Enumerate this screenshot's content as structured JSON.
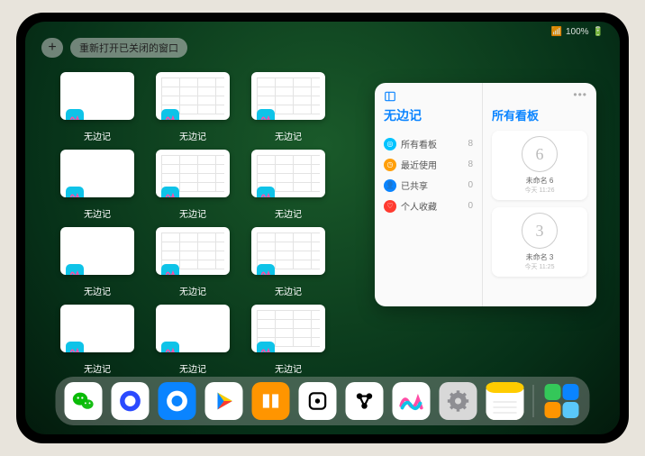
{
  "status": {
    "battery": "100%",
    "signal": "••••"
  },
  "topbar": {
    "reopen_label": "重新打开已关闭的窗口",
    "plus_glyph": "+"
  },
  "windows": [
    {
      "label": "无边记",
      "style": "blank"
    },
    {
      "label": "无边记",
      "style": "cal"
    },
    {
      "label": "无边记",
      "style": "cal"
    },
    {
      "label": "无边记",
      "style": "blank"
    },
    {
      "label": "无边记",
      "style": "cal"
    },
    {
      "label": "无边记",
      "style": "cal"
    },
    {
      "label": "无边记",
      "style": "blank"
    },
    {
      "label": "无边记",
      "style": "cal"
    },
    {
      "label": "无边记",
      "style": "cal"
    },
    {
      "label": "无边记",
      "style": "blank"
    },
    {
      "label": "无边记",
      "style": "blank"
    },
    {
      "label": "无边记",
      "style": "cal"
    }
  ],
  "popup": {
    "app_title": "无边记",
    "right_title": "所有看板",
    "categories": [
      {
        "label": "所有看板",
        "count": 8,
        "color": "#00c3ff",
        "glyph": "◎"
      },
      {
        "label": "最近使用",
        "count": 8,
        "color": "#ff9f0a",
        "glyph": "◷"
      },
      {
        "label": "已共享",
        "count": 0,
        "color": "#0a84ff",
        "glyph": "👤"
      },
      {
        "label": "个人收藏",
        "count": 0,
        "color": "#ff3b30",
        "glyph": "♡"
      }
    ],
    "boards": [
      {
        "preview": "6",
        "name": "未命名 6",
        "sub": "今天 11:26"
      },
      {
        "preview": "3",
        "name": "未命名 3",
        "sub": "今天 11:25"
      }
    ]
  },
  "dock": [
    {
      "name": "wechat",
      "bg": "#ffffff",
      "inner": "#09bb07",
      "glyph": "wechat"
    },
    {
      "name": "quark",
      "bg": "#ffffff",
      "inner": "#2b4aff",
      "glyph": "ring"
    },
    {
      "name": "qqbrowser",
      "bg": "#0a84ff",
      "inner": "#ffffff",
      "glyph": "ring"
    },
    {
      "name": "play",
      "bg": "#ffffff",
      "glyph": "play"
    },
    {
      "name": "books",
      "bg": "#ff9500",
      "glyph": "book"
    },
    {
      "name": "dice",
      "bg": "#ffffff",
      "glyph": "die"
    },
    {
      "name": "obs",
      "bg": "#ffffff",
      "glyph": "obs"
    },
    {
      "name": "freeform",
      "bg": "#ffffff",
      "glyph": "squiggle"
    },
    {
      "name": "settings",
      "bg": "#d8d8d8",
      "glyph": "gear"
    },
    {
      "name": "notes",
      "bg": "#fff5c2",
      "glyph": "notes"
    },
    {
      "name": "recents",
      "bg": "",
      "glyph": "grid4"
    }
  ]
}
